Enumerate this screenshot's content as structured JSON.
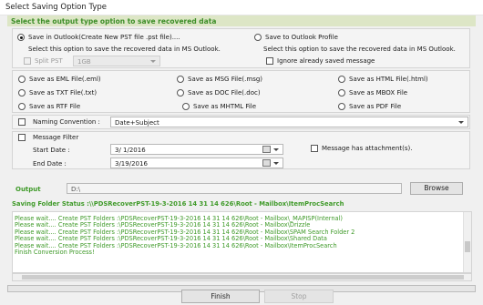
{
  "window": {
    "title": "Select Saving Option Type"
  },
  "banner": {
    "text": "Select the output type option to save recovered data"
  },
  "outlook": {
    "save_in_outlook_label": "Save in Outlook(Create New PST file .pst file)....",
    "save_to_profile_label": "Save to Outlook Profile",
    "left_desc": "Select this option to save the recovered data in MS Outlook.",
    "right_desc": "Select this option to save the recovered data in MS Outlook.",
    "split_pst_label": "Split PST",
    "split_size": "1GB",
    "ignore_saved_label": "Ignore already saved message"
  },
  "formats": {
    "eml": "Save as EML File(.eml)",
    "msg": "Save as MSG File(.msg)",
    "html": "Save as HTML File(.html)",
    "txt": "Save as TXT File(.txt)",
    "doc": "Save as DOC File(.doc)",
    "mbox": "Save as MBOX File",
    "rtf": "Save as RTF File",
    "mhtml": "Save as MHTML File",
    "pdf": "Save as PDF File"
  },
  "naming": {
    "label": "Naming Convention :",
    "value": "Date+Subject"
  },
  "filter": {
    "label": "Message Filter",
    "start_label": "Start Date :",
    "start_value": "3/  1/2016",
    "end_label": "End Date :",
    "end_value": "3/19/2016",
    "attachment_label": "Message has attachment(s)."
  },
  "output": {
    "label": "Output",
    "path": "D:\\",
    "browse_label": "Browse"
  },
  "status": {
    "text": "Saving Folder Status :\\\\PDSRecoverPST-19-3-2016 14 31 14 626\\Root - Mailbox\\ItemProcSearch"
  },
  "log": [
    "Please wait.... Create PST Folders :\\PDSRecoverPST-19-3-2016 14 31 14 626\\Root - Mailbox\\_MAPISP(Internal)",
    "Please wait.... Create PST Folders :\\PDSRecoverPST-19-3-2016 14 31 14 626\\Root - Mailbox\\Drizzle",
    "Please wait.... Create PST Folders :\\PDSRecoverPST-19-3-2016 14 31 14 626\\Root - Mailbox\\SPAM Search Folder 2",
    "Please wait.... Create PST Folders :\\PDSRecoverPST-19-3-2016 14 31 14 626\\Root - Mailbox\\Shared Data",
    "Please wait.... Create PST Folders :\\PDSRecoverPST-19-3-2016 14 31 14 626\\Root - Mailbox\\ItemProcSearch",
    "Finish Conversion Process!"
  ],
  "footer": {
    "finish_label": "Finish",
    "stop_label": "Stop"
  },
  "colors": {
    "status_green": "#3f9a29",
    "banner_bg": "#dde6c6"
  }
}
